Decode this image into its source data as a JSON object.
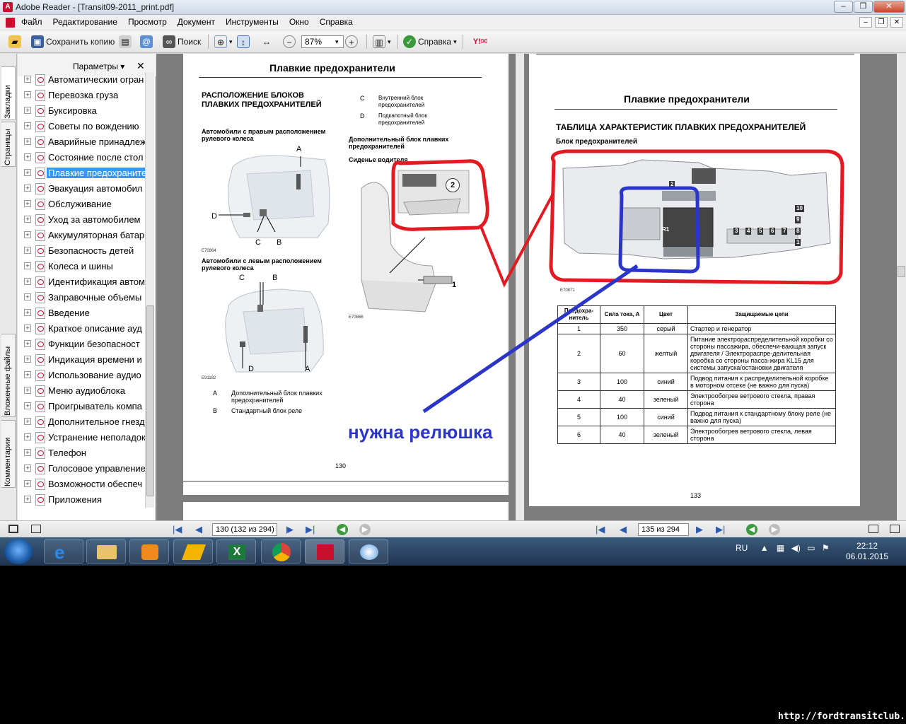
{
  "window": {
    "app_name": "Adobe Reader",
    "title": "Adobe Reader - [Transit09-2011_print.pdf]",
    "min": "–",
    "max": "❐",
    "close": "✕"
  },
  "menu": [
    "Файл",
    "Редактирование",
    "Просмотр",
    "Документ",
    "Инструменты",
    "Окно",
    "Справка"
  ],
  "toolbar": {
    "save_copy": "Сохранить копию",
    "search": "Поиск",
    "zoom": "87%",
    "help": "Справка"
  },
  "sidepanel": {
    "tabs": [
      "Закладки",
      "Страницы",
      "Вложенные файлы",
      "Комментарии"
    ],
    "params": "Параметры",
    "close": "✕",
    "bookmarks": [
      "Автоматическии огран",
      "Перевозка груза",
      "Буксировка",
      "Советы по вождению",
      "Аварийные принадлеж",
      "Состояние после стол",
      "Плавкие предохраните",
      "Эвакуация автомобил",
      "Обслуживание",
      "Уход за автомобилем",
      "Аккумуляторная батар",
      "Безопасность детей",
      "Колеса и шины",
      "Идентификация автом",
      "Заправочные объемы",
      "Введение",
      "Краткое описание ауд",
      "Функции безопасност",
      "Индикация времени и",
      "Использование аудио",
      "Меню аудиоблока",
      "Проигрыватель компа",
      "Дополнительное гнезд",
      "Устранение неполадок",
      "Телефон",
      "Голосовое управление",
      "Возможности обеспеч",
      "Приложения"
    ],
    "selected_index": 6
  },
  "left_page": {
    "title": "Плавкие предохранители",
    "section": "РАСПОЛОЖЕНИЕ БЛОКОВ ПЛАВКИХ ПРЕДОХРАНИТЕЛЕЙ",
    "rhd": "Автомобили с правым расположением рулевого колеса",
    "lhd": "Автомобили с левым расположением рулевого колеса",
    "legend_c_letter": "C",
    "legend_c": "Внутренний блок предохранителей",
    "legend_d_letter": "D",
    "legend_d": "Подкапотный блок предохранителей",
    "extra_block": "Дополнительный блок плавких предохранителей",
    "driver_seat": "Сиденье водителя",
    "legend_a_letter": "A",
    "legend_a": "Дополнительный блок плавких предохранителей",
    "legend_b_letter": "B",
    "legend_b": "Стандартный блок реле",
    "fig1": "E70864",
    "fig2": "E91182",
    "fig3": "E70866",
    "callout_2": "2",
    "callout_1": "1",
    "letters": {
      "a": "A",
      "b": "B",
      "c": "C",
      "d": "D"
    },
    "page_number": "130"
  },
  "right_page": {
    "title": "Плавкие предохранители",
    "section": "ТАБЛИЦА ХАРАКТЕРИСТИК ПЛАВКИХ ПРЕДОХРАНИТЕЛЕЙ",
    "subsection": "Блок предохранителей",
    "fig": "E70871",
    "relay_label": "R1",
    "fuse_numbers": [
      "10",
      "3",
      "4",
      "5",
      "6",
      "7",
      "8",
      "9",
      "1",
      "2"
    ],
    "columns": [
      "Предохра-нитель",
      "Сила тока, А",
      "Цвет",
      "Защищаемые цепи"
    ],
    "rows": [
      [
        "1",
        "350",
        "серый",
        "Стартер и генератор"
      ],
      [
        "2",
        "60",
        "желтый",
        "Питание электрораспределительной коробки со стороны пассажира, обеспечи-вающая запуск двигателя / Электрораспре-делительная коробка со стороны пасса-жира KL15 для системы запуска/остановки двигателя"
      ],
      [
        "3",
        "100",
        "синий",
        "Подвод питания к распределительной коробке в моторном отсеке (не важно для пуска)"
      ],
      [
        "4",
        "40",
        "зеленый",
        "Электрообогрев ветрового стекла, правая сторона"
      ],
      [
        "5",
        "100",
        "синий",
        "Подвод питания к стандартному блоку реле (не важно для пуска)"
      ],
      [
        "6",
        "40",
        "зеленый",
        "Электрообогрев ветрового стекла, левая сторона"
      ]
    ],
    "page_number": "133"
  },
  "annotation": {
    "text": "нужна релюшка",
    "red": "#e21b23",
    "blue": "#2b36c9"
  },
  "status": {
    "left_page_box": "130  (132 из 294)",
    "right_page_box": "135 из 294"
  },
  "taskbar": {
    "lang": "RU",
    "time": "22:12",
    "date": "06.01.2015"
  },
  "watermark": "http://fordtransitclub.ru"
}
